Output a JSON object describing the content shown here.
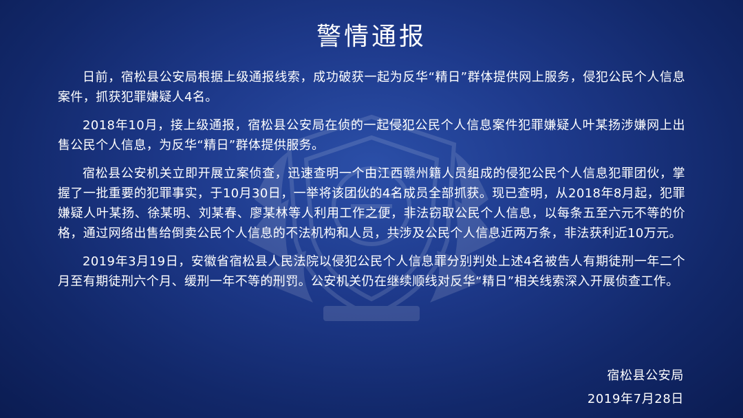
{
  "title": "警情通报",
  "paragraphs": [
    "日前，宿松县公安局根据上级通报线索，成功破获一起为反华“精日”群体提供网上服务，侵犯公民个人信息案件，抓获犯罪嫌疑人4名。",
    "2018年10月，接上级通报，宿松县公安局在侦的一起侵犯公民个人信息案件犯罪嫌疑人叶某扬涉嫌网上出售公民个人信息，为反华“精日”群体提供服务。",
    "宿松县公安机关立即开展立案侦查，迅速查明一个由江西赣州籍人员组成的侵犯公民个人信息犯罪团伙，掌握了一批重要的犯罪事实，于10月30日，一举将该团伙的4名成员全部抓获。现已查明，从2018年8月起，犯罪嫌疑人叶某扬、徐某明、刘某春、廖某林等人利用工作之便，非法窃取公民个人信息，以每条五至六元不等的价格，通过网络出售给倒卖公民个人信息的不法机构和人员，共涉及公民个人信息近两万条，非法获利近10万元。",
    "2019年3月19日，安徽省宿松县人民法院以侵犯公民个人信息罪分别判处上述4名被告人有期徒刑一年二个月至有期徒刑六个月、缓刑一年不等的刑罚。公安机关仍在继续顺线对反华“精日”相关线索深入开展侦查工作。"
  ],
  "signature": {
    "issuer": "宿松县公安局",
    "date": "2019年7月28日"
  },
  "colors": {
    "background_center": "#2b4fa8",
    "background_edge": "#0b1c52",
    "text": "#ffffff"
  },
  "watermark_icon": "police-emblem-icon"
}
